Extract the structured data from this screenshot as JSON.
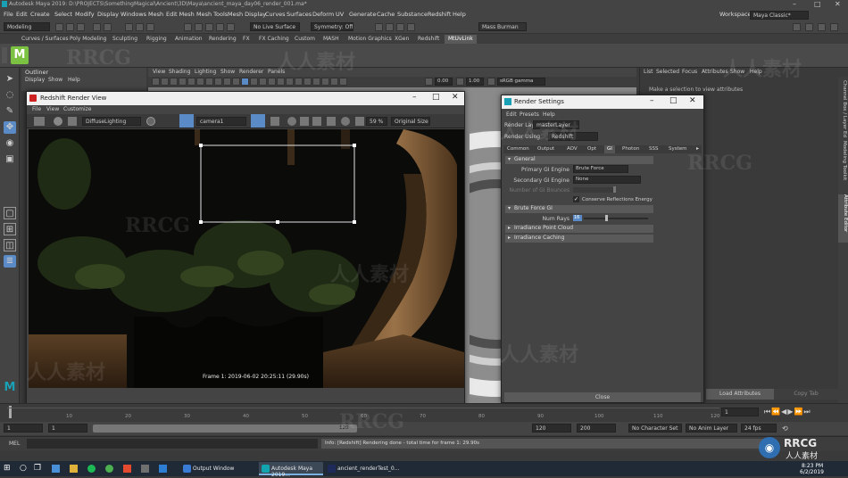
{
  "app": {
    "title": "Autodesk Maya 2019: D:\\PROJECTS\\SomethingMagical\\Ancient\\3D\\Maya\\ancient_maya_day06_render_001.ma*",
    "window_controls": [
      "–",
      "□",
      "✕"
    ]
  },
  "menubar": {
    "items": [
      "File",
      "Edit",
      "Create",
      "Select",
      "Modify",
      "Display",
      "Windows",
      "Mesh",
      "Edit Mesh",
      "Mesh Tools",
      "Mesh Display",
      "Curves",
      "Surfaces",
      "Deform",
      "UV",
      "Generate",
      "Cache",
      "Substance",
      "Redshift",
      "Help"
    ],
    "workspace_label": "Workspace :",
    "workspace_value": "Maya Classic*"
  },
  "statusline": {
    "mode": "Modeling",
    "live_surface": "No Live Surface",
    "symmetry": "Symmetry: Off",
    "user": "Mass Burman"
  },
  "shelf": {
    "tabs": [
      "Curves / Surfaces",
      "Poly Modeling",
      "Sculpting",
      "Rigging",
      "Animation",
      "Rendering",
      "FX",
      "FX Caching",
      "Custom",
      "MASH",
      "Motion Graphics",
      "XGen",
      "Redshift",
      "MtUvLink"
    ],
    "active_tab": "MtUvLink"
  },
  "outliner": {
    "title": "Outliner",
    "menu": [
      "Display",
      "Show",
      "Help"
    ]
  },
  "viewport": {
    "menu": [
      "View",
      "Shading",
      "Lighting",
      "Show",
      "Renderer",
      "Panels"
    ],
    "value_a": "0.00",
    "value_b": "1.00",
    "color_space": "sRGB gamma"
  },
  "attribute_panel": {
    "menu": [
      "List",
      "Selected",
      "Focus",
      "Attributes",
      "Show",
      "Help"
    ],
    "message": "Make a selection to view attributes",
    "side_tabs": [
      "Channel Box / Layer Editor",
      "Modeling Toolkit",
      "Attribute Editor"
    ],
    "load_button": "Load Attributes",
    "copy_tab": "Copy Tab"
  },
  "render_view": {
    "title": "Redshift Render View",
    "menu": [
      "File",
      "View",
      "Customize"
    ],
    "aov": "DiffuseLighting",
    "camera": "camera1",
    "zoom": "59 %",
    "size": "Original Size",
    "frame_info": "Frame  1:  2019-06-02  20:25:11  (29.90s)"
  },
  "render_settings": {
    "title": "Render Settings",
    "menu": [
      "Edit",
      "Presets",
      "Help"
    ],
    "render_layer_label": "Render Layer",
    "render_layer": "masterLayer",
    "render_using_label": "Render Using",
    "render_using": "Redshift",
    "tabs": [
      "Common",
      "Output",
      "AOV",
      "Opt",
      "GI",
      "Photon",
      "SSS",
      "System"
    ],
    "active_tab": "GI",
    "sections": {
      "general": "General",
      "brute_force": "Brute Force GI",
      "irradiance_point_cloud": "Irradiance Point Cloud",
      "irradiance_caching": "Irradiance Caching"
    },
    "primary_label": "Primary GI Engine",
    "primary": "Brute Force",
    "secondary_label": "Secondary GI Engine",
    "secondary": "None",
    "bounces_label": "Number of GI Bounces",
    "conserve_label": "Conserve Reflections Energy",
    "conserve_checked": true,
    "num_rays_label": "Num Rays",
    "num_rays": "16",
    "close": "Close"
  },
  "timeline": {
    "range_start": "1",
    "range_start_inner": "1",
    "range_end_inner": "120",
    "range_end": "120",
    "anim_end": "200",
    "character_set": "No Character Set",
    "anim_layer": "No Anim Layer",
    "fps": "24 fps",
    "current_frame": "1",
    "ticks": [
      "10",
      "20",
      "30",
      "40",
      "50",
      "60",
      "70",
      "80",
      "90",
      "100",
      "110",
      "120"
    ]
  },
  "cmdline": {
    "label": "MEL",
    "message": "Info: [Redshift] Rendering done - total time for frame 1: 29.90s"
  },
  "taskbar": {
    "items": [
      {
        "label": "Output Window",
        "color": "#3a7bd5"
      },
      {
        "label": "Autodesk Maya 2019...",
        "color": "#12a5b0"
      },
      {
        "label": "ancient_renderTest_0...",
        "color": "#1e2a5a"
      }
    ],
    "time": "8:23 PM",
    "date": "6/2/2019"
  },
  "watermark": {
    "text_a": "RRCG",
    "text_b": "人人素材"
  },
  "colors": {
    "accent": "#5b8bc7",
    "brand_green": "#7cc242"
  }
}
